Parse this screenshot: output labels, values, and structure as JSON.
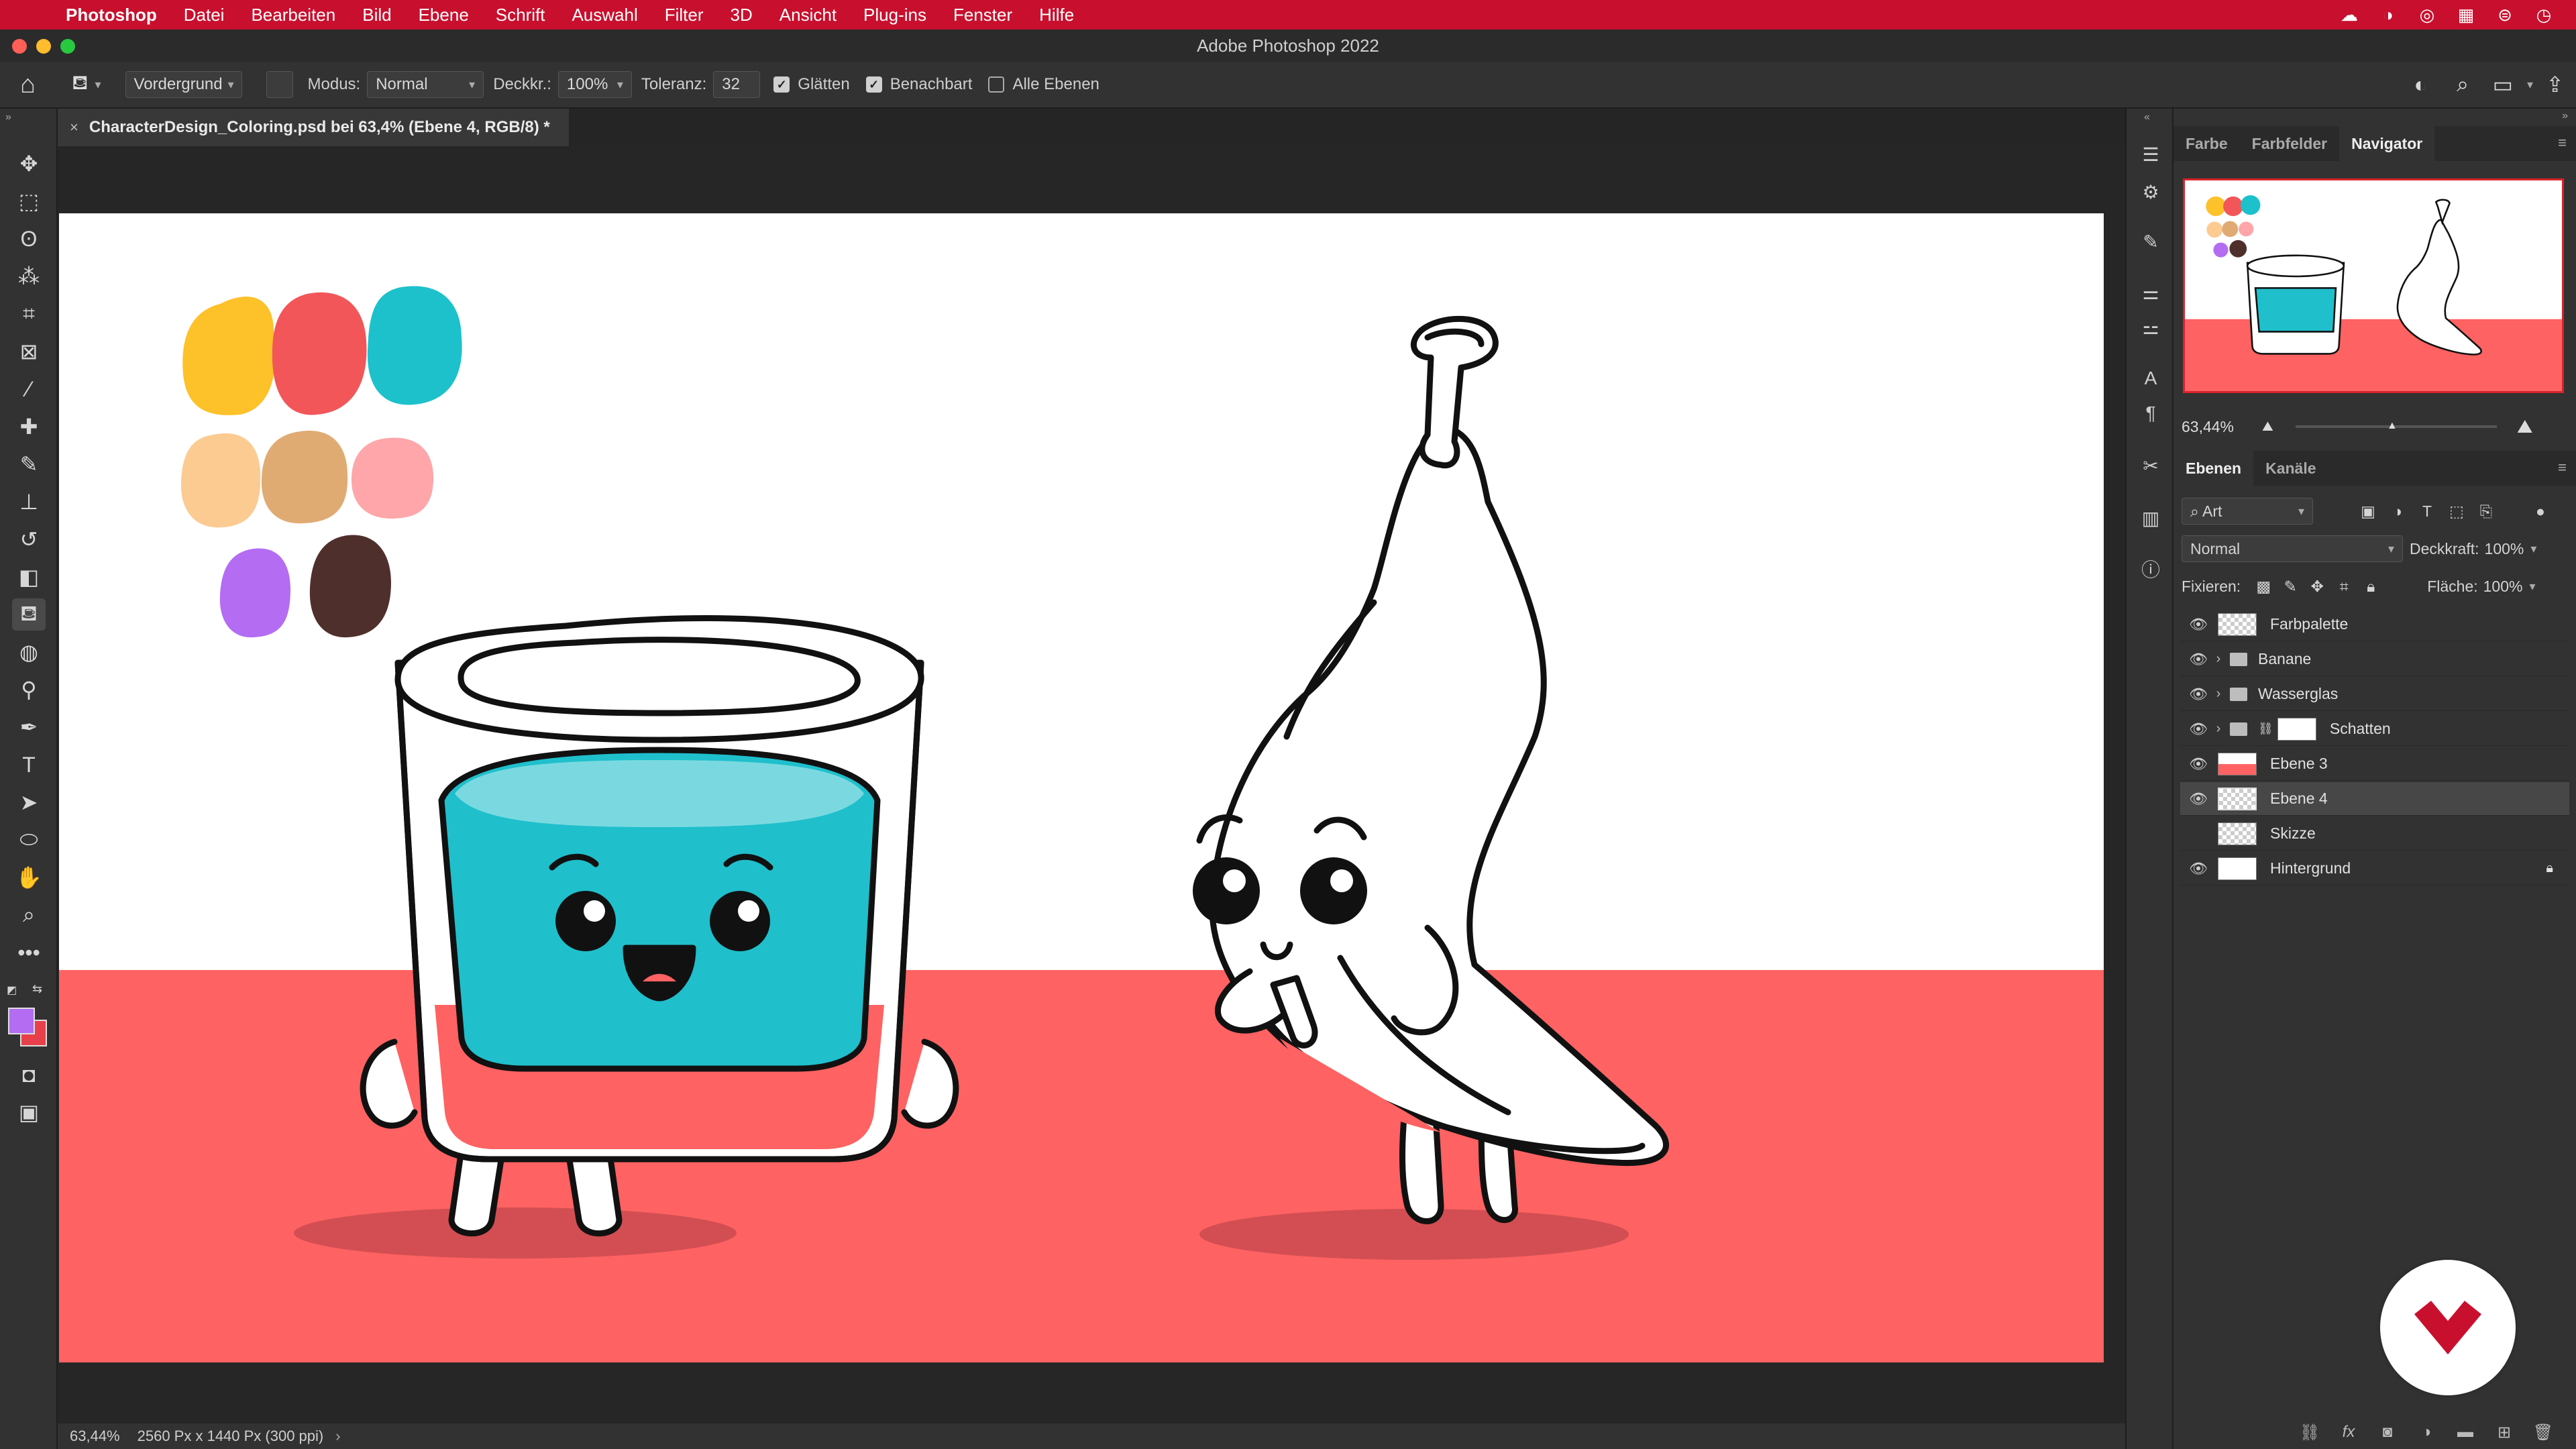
{
  "menubar": {
    "app_name": "Photoshop",
    "items": [
      "Datei",
      "Bearbeiten",
      "Bild",
      "Ebene",
      "Schrift",
      "Auswahl",
      "Filter",
      "3D",
      "Ansicht",
      "Plug-ins",
      "Fenster",
      "Hilfe"
    ]
  },
  "window": {
    "title": "Adobe Photoshop 2022"
  },
  "options": {
    "fill_source": "Vordergrund",
    "mode_label": "Modus:",
    "mode_value": "Normal",
    "opacity_label": "Deckkr.:",
    "opacity_value": "100%",
    "tolerance_label": "Toleranz:",
    "tolerance_value": "32",
    "antialias_label": "Glätten",
    "contiguous_label": "Benachbart",
    "all_layers_label": "Alle Ebenen"
  },
  "document": {
    "tab_title": "CharacterDesign_Coloring.psd bei 63,4% (Ebene 4, RGB/8) *"
  },
  "status": {
    "zoom": "63,44%",
    "doc_info": "2560 Px x 1440 Px (300 ppi)"
  },
  "panels": {
    "top_tabs": [
      "Farbe",
      "Farbfelder",
      "Navigator"
    ],
    "nav_zoom": "63,44%",
    "layer_tabs": [
      "Ebenen",
      "Kanäle"
    ],
    "filter_kind": "Art",
    "blend_mode": "Normal",
    "opacity_label": "Deckkraft:",
    "opacity_value": "100%",
    "lock_label": "Fixieren:",
    "fill_label": "Fläche:",
    "fill_value": "100%"
  },
  "layers": [
    {
      "name": "Farbpalette",
      "visible": true,
      "group": false
    },
    {
      "name": "Banane",
      "visible": true,
      "group": true
    },
    {
      "name": "Wasserglas",
      "visible": true,
      "group": true
    },
    {
      "name": "Schatten",
      "visible": true,
      "group": true
    },
    {
      "name": "Ebene 3",
      "visible": true,
      "group": false
    },
    {
      "name": "Ebene 4",
      "visible": true,
      "group": false,
      "selected": true
    },
    {
      "name": "Skizze",
      "visible": false,
      "group": false
    },
    {
      "name": "Hintergrund",
      "visible": true,
      "group": false,
      "locked": true
    }
  ],
  "colors": {
    "accent_red": "#c8102e",
    "floor_pink": "#ff6262",
    "water_teal": "#1fbfcc",
    "foreground": "#b36cf2",
    "background": "#e8404a",
    "palette": [
      "#fdc12a",
      "#f25659",
      "#1dc1cc",
      "#fccb92",
      "#e0ab73",
      "#fea6a9",
      "#b36cf2",
      "#4f2f2c"
    ]
  }
}
